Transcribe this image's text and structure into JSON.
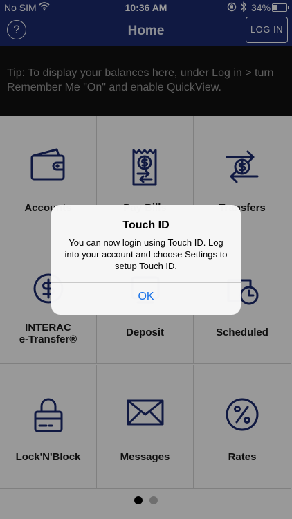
{
  "status": {
    "carrier": "No SIM",
    "time": "10:36 AM",
    "battery": "34%",
    "battery_level": 0.34
  },
  "nav": {
    "help_label": "?",
    "title": "Home",
    "login_label": "LOG IN"
  },
  "tip": "Tip: To display your balances here, under Log in > turn Remember Me \"On\" and enable QuickView.",
  "tiles": [
    {
      "label": "Accounts",
      "icon": "wallet-icon"
    },
    {
      "label": "Pay Bills",
      "icon": "bill-icon"
    },
    {
      "label": "Transfers",
      "icon": "transfer-icon"
    },
    {
      "label_line1": "INTERAC",
      "label_line2": "e-Transfer®",
      "icon": "dollar-circle-icon"
    },
    {
      "label": "Deposit",
      "icon": "deposit-icon"
    },
    {
      "label": "Scheduled",
      "icon": "clock-calendar-icon"
    },
    {
      "label": "Lock'N'Block",
      "icon": "lock-card-icon"
    },
    {
      "label": "Messages",
      "icon": "envelope-icon"
    },
    {
      "label": "Rates",
      "icon": "percent-icon"
    }
  ],
  "pager": {
    "pages": 2,
    "current": 1
  },
  "alert": {
    "title": "Touch ID",
    "message": "You can now login using Touch ID. Log into your account and choose Settings to setup Touch ID.",
    "ok_label": "OK"
  },
  "colors": {
    "brand": "#1c2a6e",
    "tip_bg": "#111111",
    "link": "#1a73e8"
  }
}
